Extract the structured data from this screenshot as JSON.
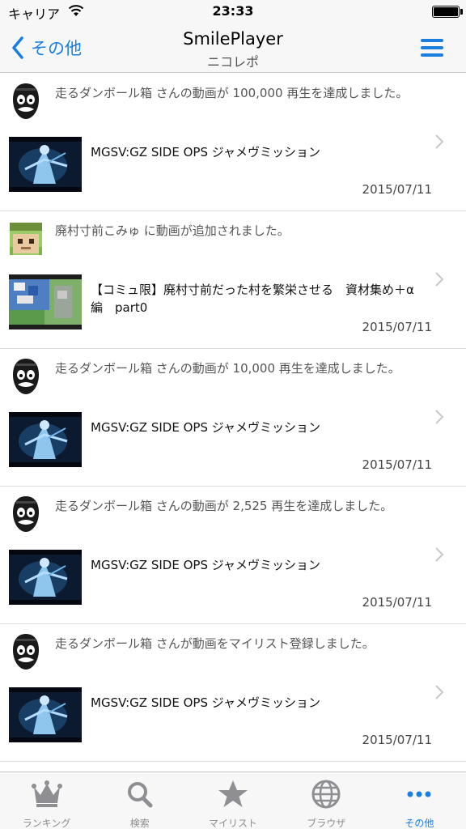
{
  "status_bar": {
    "carrier": "キャリア",
    "time": "23:33",
    "battery_level": 1.0
  },
  "nav": {
    "back_label": "その他",
    "title": "SmilePlayer",
    "subtitle": "ニコレポ",
    "menu_icon": "hamburger-menu-icon"
  },
  "feed": {
    "items": [
      {
        "avatar": "mask-avatar",
        "message": "走るダンボール箱 さんの動画が 100,000 再生を達成しました。",
        "video_title": "MGSV:GZ SIDE OPS ジャメヴミッション",
        "date": "2015/07/11",
        "thumb": "mgsv"
      },
      {
        "avatar": "minecraft-avatar",
        "message": "廃村寸前こみゅ に動画が追加されました。",
        "video_title": "【コミュ限】廃村寸前だった村を繁栄させる　資材集め＋α編　part0",
        "date": "2015/07/11",
        "thumb": "minecraft"
      },
      {
        "avatar": "mask-avatar",
        "message": "走るダンボール箱 さんの動画が 10,000 再生を達成しました。",
        "video_title": "MGSV:GZ SIDE OPS ジャメヴミッション",
        "date": "2015/07/11",
        "thumb": "mgsv"
      },
      {
        "avatar": "mask-avatar",
        "message": "走るダンボール箱 さんの動画が 2,525 再生を達成しました。",
        "video_title": "MGSV:GZ SIDE OPS ジャメヴミッション",
        "date": "2015/07/11",
        "thumb": "mgsv"
      },
      {
        "avatar": "mask-avatar",
        "message": "走るダンボール箱 さんが動画をマイリスト登録しました。",
        "video_title": "MGSV:GZ SIDE OPS ジャメヴミッション",
        "date": "2015/07/11",
        "thumb": "mgsv"
      }
    ]
  },
  "tab_bar": {
    "tabs": [
      {
        "label": "ランキング",
        "icon": "crown-icon",
        "active": false
      },
      {
        "label": "検索",
        "icon": "search-icon",
        "active": false
      },
      {
        "label": "マイリスト",
        "icon": "star-icon",
        "active": false
      },
      {
        "label": "ブラウザ",
        "icon": "globe-icon",
        "active": false
      },
      {
        "label": "その他",
        "icon": "more-icon",
        "active": true
      }
    ]
  },
  "colors": {
    "accent": "#1a7de0",
    "inactive": "#8e8e93"
  }
}
